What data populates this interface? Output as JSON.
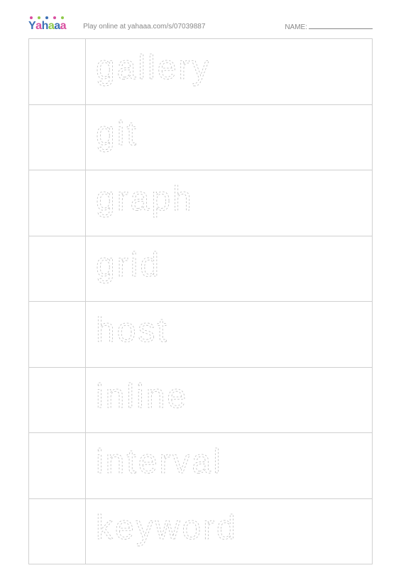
{
  "header": {
    "logo": {
      "chars": [
        "Y",
        "a",
        "h",
        "a",
        "a",
        "a"
      ]
    },
    "play_text": "Play online at yahaaa.com/s/07039887",
    "name_label": "NAME:"
  },
  "worksheet": {
    "rows": [
      {
        "word": "gallery"
      },
      {
        "word": "git"
      },
      {
        "word": "graph"
      },
      {
        "word": "grid"
      },
      {
        "word": "host"
      },
      {
        "word": "inline"
      },
      {
        "word": "interval"
      },
      {
        "word": "keyword"
      }
    ]
  }
}
